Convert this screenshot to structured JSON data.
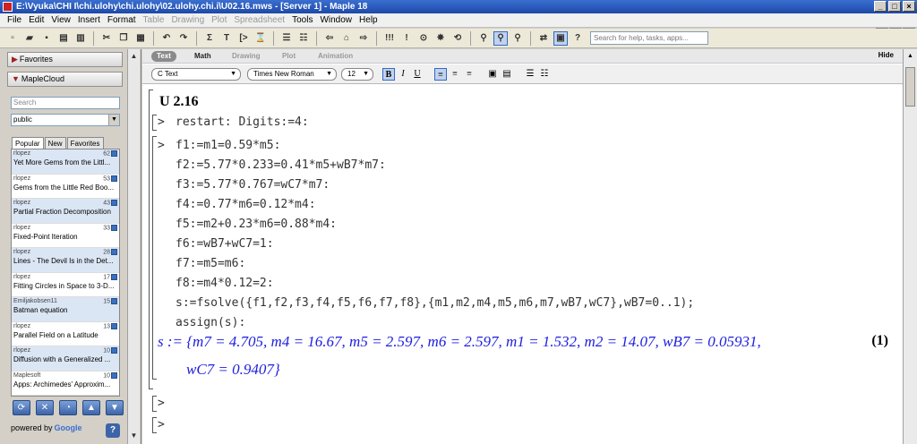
{
  "window": {
    "title": "E:\\Vyuka\\CHI I\\chi.ulohy\\chi.ulohy\\02.ulohy.chi.i\\U02.16.mws - [Server 1] - Maple 18"
  },
  "menu": [
    {
      "label": "File",
      "enabled": true
    },
    {
      "label": "Edit",
      "enabled": true
    },
    {
      "label": "View",
      "enabled": true
    },
    {
      "label": "Insert",
      "enabled": true
    },
    {
      "label": "Format",
      "enabled": true
    },
    {
      "label": "Table",
      "enabled": false
    },
    {
      "label": "Drawing",
      "enabled": false
    },
    {
      "label": "Plot",
      "enabled": false
    },
    {
      "label": "Spreadsheet",
      "enabled": false
    },
    {
      "label": "Tools",
      "enabled": true
    },
    {
      "label": "Window",
      "enabled": true
    },
    {
      "label": "Help",
      "enabled": true
    }
  ],
  "toolbar": {
    "help_placeholder": "Search for help, tasks, apps..."
  },
  "palettes": {
    "favorites": "Favorites",
    "maplecloud": "MapleCloud",
    "search_placeholder": "Search",
    "group": "public",
    "tabs": [
      "Popular",
      "New",
      "Favorites"
    ],
    "items": [
      {
        "author": "rlopez",
        "count": "62",
        "title": "Yet More Gems from the Littl..."
      },
      {
        "author": "rlopez",
        "count": "53",
        "title": "Gems from the Little Red Boo..."
      },
      {
        "author": "rlopez",
        "count": "43",
        "title": "Partial Fraction Decomposition"
      },
      {
        "author": "rlopez",
        "count": "33",
        "title": "Fixed-Point Iteration"
      },
      {
        "author": "rlopez",
        "count": "28",
        "title": "Lines - The Devil Is in the Det..."
      },
      {
        "author": "rlopez",
        "count": "17",
        "title": "Fitting Circles in Space to 3-D..."
      },
      {
        "author": "Emiljakobsen11",
        "count": "15",
        "title": "Batman equation"
      },
      {
        "author": "rlopez",
        "count": "13",
        "title": "Parallel Field on a Latitude"
      },
      {
        "author": "rlopez",
        "count": "10",
        "title": "Diffusion with a Generalized ..."
      },
      {
        "author": "Maplesoft",
        "count": "10",
        "title": "Apps: Archimedes' Approxim..."
      }
    ],
    "powered_by": "powered by",
    "google": "Google"
  },
  "modes": {
    "text": "Text",
    "math": "Math",
    "drawing": "Drawing",
    "plot": "Plot",
    "animation": "Animation",
    "hide": "Hide"
  },
  "format": {
    "style": "Text",
    "font": "Times New Roman",
    "size": "12"
  },
  "worksheet": {
    "heading": "U 2.16",
    "line1": "restart: Digits:=4:",
    "lines": [
      "f1:=m1=0.59*m5:",
      "f2:=5.77*0.233=0.41*m5+wB7*m7:",
      "f3:=5.77*0.767=wC7*m7:",
      "f4:=0.77*m6=0.12*m4:",
      "f5:=m2+0.23*m6=0.88*m4:",
      "f6:=wB7+wC7=1:",
      "f7:=m5=m6:",
      "f8:=m4*0.12=2:",
      "s:=fsolve({f1,f2,f3,f4,f5,f6,f7,f8},{m1,m2,m4,m5,m6,m7,wB7,wC7},wB7=0..1);",
      "assign(s):"
    ],
    "output1": "s := {m7 = 4.705, m4 = 16.67, m5 = 2.597, m6 = 2.597, m1 = 1.532, m2 = 14.07, wB7 = 0.05931,",
    "output2": "wC7 = 0.9407}",
    "eq_label": "(1)",
    "prompt": ">"
  }
}
